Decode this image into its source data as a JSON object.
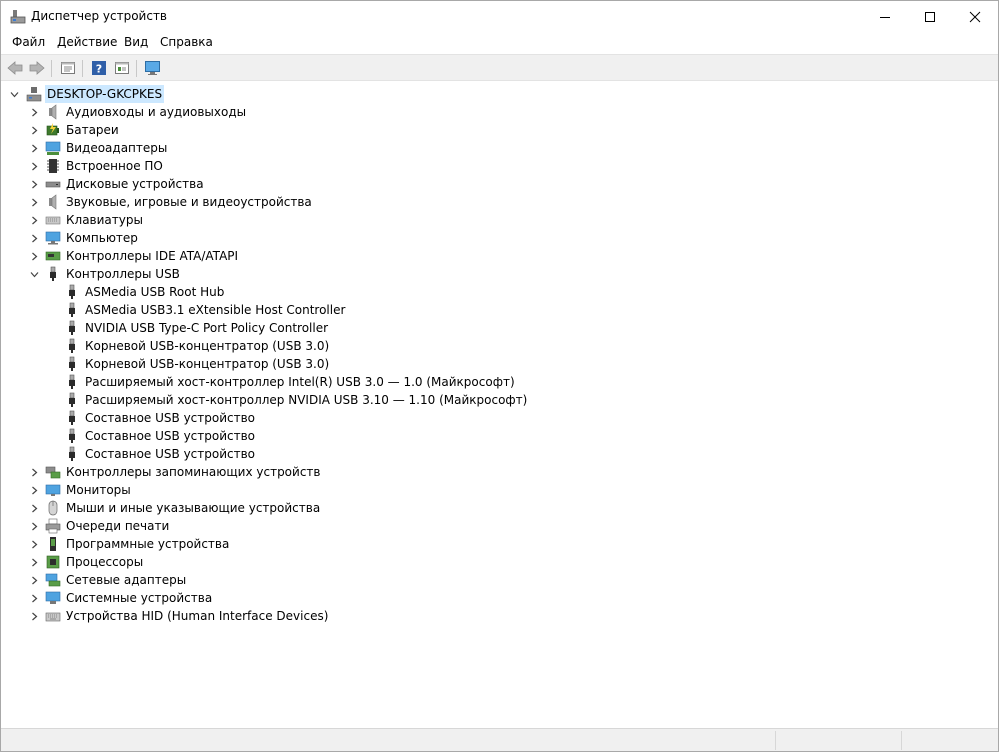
{
  "window": {
    "title": "Диспетчер устройств"
  },
  "menu": [
    "Файл",
    "Действие",
    "Вид",
    "Справка"
  ],
  "toolbar": {
    "buttons": [
      "back-icon",
      "forward-icon",
      "properties-icon",
      "help-icon",
      "show-hidden-icon",
      "monitor-scan-icon"
    ]
  },
  "tree": {
    "root": "DESKTOP-GKCPKES",
    "categories": [
      {
        "label": "Аудиовходы и аудиовыходы",
        "icon": "speaker-icon"
      },
      {
        "label": "Батареи",
        "icon": "battery-icon"
      },
      {
        "label": "Видеоадаптеры",
        "icon": "display-adapter-icon"
      },
      {
        "label": "Встроенное ПО",
        "icon": "firmware-chip-icon"
      },
      {
        "label": "Дисковые устройства",
        "icon": "disk-drive-icon"
      },
      {
        "label": "Звуковые, игровые и видеоустройства",
        "icon": "speaker-icon"
      },
      {
        "label": "Клавиатуры",
        "icon": "keyboard-icon"
      },
      {
        "label": "Компьютер",
        "icon": "computer-icon"
      },
      {
        "label": "Контроллеры IDE ATA/ATAPI",
        "icon": "ide-controller-icon"
      },
      {
        "label": "Контроллеры USB",
        "icon": "usb-plug-icon",
        "expanded": true
      },
      {
        "label": "Контроллеры запоминающих устройств",
        "icon": "storage-controller-icon"
      },
      {
        "label": "Мониторы",
        "icon": "monitor-icon"
      },
      {
        "label": "Мыши и иные указывающие устройства",
        "icon": "mouse-icon"
      },
      {
        "label": "Очереди печати",
        "icon": "printer-icon"
      },
      {
        "label": "Программные устройства",
        "icon": "software-device-icon"
      },
      {
        "label": "Процессоры",
        "icon": "processor-icon"
      },
      {
        "label": "Сетевые адаптеры",
        "icon": "network-adapter-icon"
      },
      {
        "label": "Системные устройства",
        "icon": "system-device-icon"
      },
      {
        "label": "Устройства HID (Human Interface Devices)",
        "icon": "hid-icon"
      }
    ],
    "usb_children": [
      "ASMedia USB Root Hub",
      "ASMedia USB3.1 eXtensible Host Controller",
      "NVIDIA USB Type-C Port Policy Controller",
      "Корневой USB-концентратор (USB 3.0)",
      "Корневой USB-концентратор (USB 3.0)",
      "Расширяемый хост-контроллер Intel(R) USB 3.0 — 1.0 (Майкрософт)",
      "Расширяемый хост-контроллер NVIDIA USB 3.10 — 1.10 (Майкрософт)",
      "Составное USB устройство",
      "Составное USB устройство",
      "Составное USB устройство"
    ]
  }
}
